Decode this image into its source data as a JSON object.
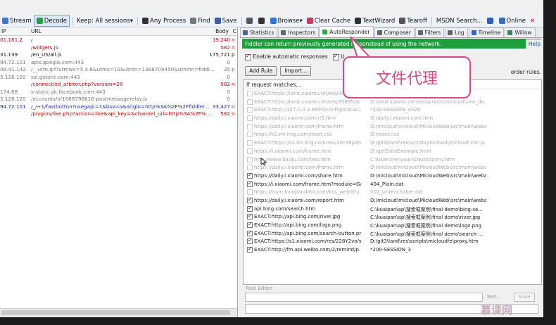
{
  "toolbar": [
    {
      "id": "stream",
      "label": "Stream",
      "icon": "stream-icon",
      "color": "#3a7ad0"
    },
    {
      "id": "decode",
      "label": "Decode",
      "icon": "decode-icon",
      "color": "#2e9a4c",
      "pressed": true
    },
    {
      "id": "keep",
      "label": "Keep: All sessions",
      "icon": "",
      "color": "",
      "dropdown": true
    },
    {
      "id": "process",
      "label": "Any Process",
      "icon": "crosshair-icon",
      "color": "#333"
    },
    {
      "id": "find",
      "label": "Find",
      "icon": "find-icon",
      "color": "#777"
    },
    {
      "id": "save",
      "label": "Save",
      "icon": "save-icon",
      "color": "#3a5fa8"
    },
    {
      "id": "screenshot",
      "label": "",
      "icon": "camera-icon",
      "color": "#556"
    },
    {
      "id": "timer",
      "label": "",
      "icon": "timer-icon",
      "color": "#333"
    },
    {
      "id": "browse",
      "label": "Browse",
      "icon": "browse-icon",
      "color": "#2f74c8",
      "dropdown": true
    },
    {
      "id": "clearcache",
      "label": "Clear Cache",
      "icon": "clear-cache-icon",
      "color": "#c04060"
    },
    {
      "id": "textwizard",
      "label": "TextWizard",
      "icon": "text-wizard-icon",
      "color": "#333"
    },
    {
      "id": "tearoff",
      "label": "Tearoff",
      "icon": "tearoff-icon",
      "color": "#555"
    },
    {
      "id": "msdn",
      "label": "MSDN Search...",
      "icon": "",
      "color": ""
    },
    {
      "id": "help",
      "label": "",
      "icon": "help-icon",
      "color": "#2f5fb5"
    },
    {
      "id": "online",
      "label": "Online",
      "icon": "online-icon",
      "color": "#3a6fc0"
    },
    {
      "id": "close",
      "label": "✕",
      "icon": "",
      "color": "#c00"
    }
  ],
  "sessions": {
    "columns": {
      "ip": "IP",
      "url": "URL",
      "body": "Body",
      "c": "C"
    },
    "rows": [
      {
        "ip": "01.161.2",
        "url": "/",
        "body": "19,240",
        "c": "n",
        "color": "#cc0000"
      },
      {
        "ip": "",
        "url": "/widgets.js",
        "body": "582",
        "c": "n",
        "color": "#cc0000"
      },
      {
        "ip": "31.139",
        "url": "/en_US/all.js",
        "body": "175,721",
        "c": "p",
        "color": "#111111"
      },
      {
        "ip": "94.72.101",
        "url": "apis.google.com:443",
        "body": "0",
        "c": "",
        "color": "#777777"
      },
      {
        "ip": "08.41.142",
        "url": "/__utm.gif?utmwv=5.4.6&utms=10&utmn=1388709450&utmhn=fiddl...",
        "body": "35",
        "c": "p",
        "color": "#777777"
      },
      {
        "ip": "5.128.120",
        "url": "ssl.gstatic.com:443",
        "body": "0",
        "c": "",
        "color": "#777777"
      },
      {
        "ip": "",
        "url": "/connect/xd_arbiter.php?version=28",
        "body": "582",
        "c": "n",
        "color": "#cc0000"
      },
      {
        "ip": "174.68",
        "url": "s-static.ak.facebook.com:443",
        "body": "0",
        "c": "",
        "color": "#777777"
      },
      {
        "ip": "5.128.120",
        "url": "/accounts/o/1088796616-postmessagerelay.js",
        "body": "0",
        "c": "",
        "color": "#777777"
      },
      {
        "ip": "94.72.101",
        "url": "/_/+1/fastbutton?usegapi=1&bsv=o&origin=http%3A%2F%2Ffiddler...",
        "body": "33,427",
        "c": "n",
        "color": "#1b2aa8"
      },
      {
        "ip": "",
        "url": "/plugins/like.php?action=like&api_key=&channel_url=http%3A%2F%...",
        "body": "582",
        "c": "n",
        "color": "#cc0000"
      }
    ]
  },
  "tabs": [
    {
      "label": "Statistics",
      "icon": "statistics-icon",
      "color": "#4466aa"
    },
    {
      "label": "Inspectors",
      "icon": "inspectors-icon",
      "color": "#666666"
    },
    {
      "label": "AutoResponder",
      "icon": "lightning-icon",
      "color": "#2ea844",
      "active": true
    },
    {
      "label": "Composer",
      "icon": "composer-icon",
      "color": "#666666"
    },
    {
      "label": "Filters",
      "icon": "filters-icon",
      "color": "#666666"
    },
    {
      "label": "Log",
      "icon": "log-icon",
      "color": "#666666"
    },
    {
      "label": "Timeline",
      "icon": "timeline-icon",
      "color": "#3366cc"
    },
    {
      "label": "Willow",
      "icon": "willow-icon",
      "color": "#2e8b57"
    }
  ],
  "banner": {
    "text": "Fiddler can return previously generated respo",
    "text2": "nstead of using the network.",
    "help": "Help",
    "bg": "#1e9d3c"
  },
  "options": {
    "enable_label": "Enable automatic responses",
    "unmatched_label": "U"
  },
  "buttons": {
    "add_rule": "Add Rule",
    "import": "Import..."
  },
  "order_text": "order rules.",
  "rules": {
    "header": "If request matches...",
    "rows": [
      {
        "match": "EXACT:https://land.xiaomi.net/res/70",
        "action": "",
        "enabled": false
      },
      {
        "match": "EXACT:https://land.xiaomi.net/res/70895/sc...",
        "action": "D:\\land.xiaomi.net\\res\\scripts\\micloud\\sms_de...",
        "enabled": false
      },
      {
        "match": "EXACT:http://127.0.0.1:8895/config/status.j...",
        "action": "*200-SESSION_4528",
        "enabled": false
      },
      {
        "match": "https://daily.i.xiaomi.com/r/3.htm",
        "action": "D:\\daily.i.xiaomi.com.htm",
        "enabled": false
      },
      {
        "match": "https://daily.i.xiaomi.com/frame.htm",
        "action": "D:\\micloud\\micloud\\MicloudWeb\\src\\main\\weba...",
        "enabled": false
      },
      {
        "match": "https://s1.mi-img.com/reset.css",
        "action": "D:\\reset.css",
        "enabled": false
      },
      {
        "match": "EXACT:https://s1.mi-img.com/res/20cY8pd/s...",
        "action": "D:\\git3\\land\\res\\scripts\\micloud\\micloud-chn.js",
        "enabled": false
      },
      {
        "match": "https://i.xiaomi.com/frame.htm",
        "action": "D:\\getDataExample.html",
        "enabled": false
      },
      {
        "match": "http://www.baidu.com/test.htm",
        "action": "C:\\Users\\renyuan\\Desktop\\my.htm",
        "enabled": false
      },
      {
        "match": "https://daily.i.xiaomi.com/frame.htm",
        "action": "D:\\micloud\\micloud\\MicloudWeb\\src\\main\\webo...",
        "enabled": false
      },
      {
        "match": "https://daily.i.xiaomi.com/share.htm",
        "action": "D:\\micloud\\micloud\\MicloudWeb\\src\\main\\weba...",
        "enabled": true
      },
      {
        "match": "https://i.xiaomi.com/frame.htm?module=Gall...",
        "action": "404_Plain.dat",
        "enabled": true
      },
      {
        "match": "https://issm.kuaipandata.com/kss_web/thu...",
        "action": "502_Unreachable.dat",
        "enabled": false
      },
      {
        "match": "https://daily.i.xiaomi.com/report.htm",
        "action": "D:\\micloud\\micloud\\MicloudWeb\\src\\main\\weba...",
        "enabled": true
      },
      {
        "match": "api.bing.com/search.htm",
        "action": "C:\\kuaipan\\ap\\搜索框案例\\final demo\\bing-se...",
        "enabled": true
      },
      {
        "match": "EXACT:http://api.bing.com/river.jpg",
        "action": "C:\\kuaipan\\ap\\搜索框案例\\final demo\\river.jpg",
        "enabled": true
      },
      {
        "match": "EXACT:http://api.bing.com/logo.png",
        "action": "C:\\kuaipan\\ap\\搜索框案例\\final demo\\logo.png",
        "enabled": true
      },
      {
        "match": "EXACT:http://api.bing.com/search-button.png",
        "action": "C:\\kuaipan\\ap\\搜索框案例\\final demo\\search-...",
        "enabled": true
      },
      {
        "match": "EXACT:https://s1.xiaomi.com/res/228Y2vo/sc...",
        "action": "D:\\git3\\land\\res\\scripts\\micloudfe\\proxy.htm",
        "enabled": true
      },
      {
        "match": "EXACT:http://fm.api.weibo.com/2/remind/p...",
        "action": "*200-SESSION_3",
        "enabled": true
      }
    ]
  },
  "editor": {
    "label": "Rule Editor",
    "test": "Test...",
    "save": "Save"
  },
  "callout": {
    "text": "文件代理",
    "color": "#d64a86"
  },
  "watermark": "慕课网"
}
